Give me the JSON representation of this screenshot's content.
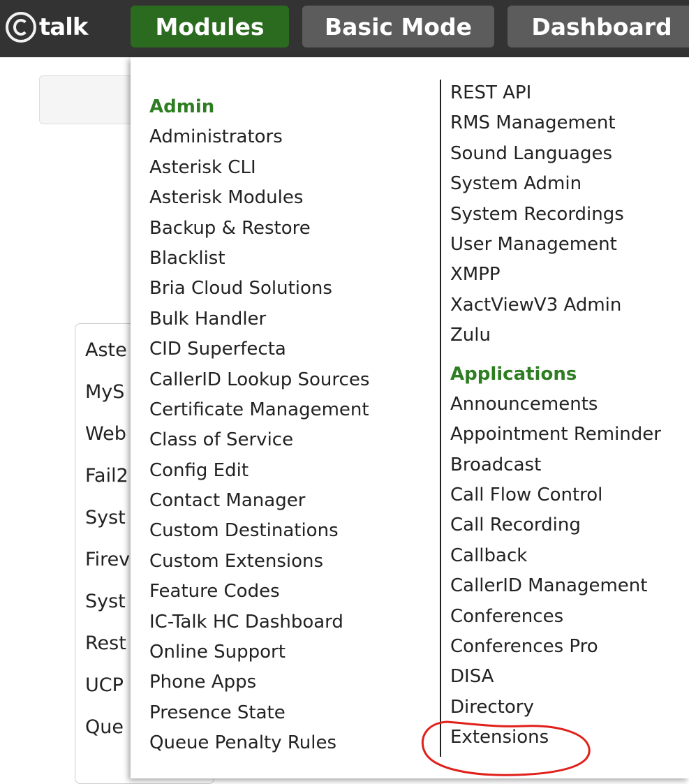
{
  "header": {
    "logo_text": "talk",
    "nav": [
      {
        "label": "Modules"
      },
      {
        "label": "Basic Mode"
      },
      {
        "label": "Dashboard"
      }
    ]
  },
  "background_list": [
    "Aste",
    "MyS",
    "Web",
    "Fail2",
    "Syst",
    "Firev",
    "Syst",
    "Rest",
    "UCP",
    "Que"
  ],
  "menu": {
    "admin_title": "Admin",
    "admin_items": [
      "Administrators",
      "Asterisk CLI",
      "Asterisk Modules",
      "Backup & Restore",
      "Blacklist",
      "Bria Cloud Solutions",
      "Bulk Handler",
      "CID Superfecta",
      "CallerID Lookup Sources",
      "Certificate Management",
      "Class of Service",
      "Config Edit",
      "Contact Manager",
      "Custom Destinations",
      "Custom Extensions",
      "Feature Codes",
      "IC-Talk HC Dashboard",
      "Online Support",
      "Phone Apps",
      "Presence State",
      "Queue Penalty Rules"
    ],
    "admin_items_cont": [
      "REST API",
      "RMS Management",
      "Sound Languages",
      "System Admin",
      "System Recordings",
      "User Management",
      "XMPP",
      "XactViewV3 Admin",
      "Zulu"
    ],
    "apps_title": "Applications",
    "apps_items": [
      "Announcements",
      "Appointment Reminder",
      "Broadcast",
      "Call Flow Control",
      "Call Recording",
      "Callback",
      "CallerID Management",
      "Conferences",
      "Conferences Pro",
      "DISA",
      "Directory",
      "Extensions"
    ]
  },
  "colors": {
    "nav_active": "#2a6b1f",
    "nav_inactive": "#5c5c5c",
    "section_title": "#2e7d22",
    "annotation": "#e0201a"
  }
}
